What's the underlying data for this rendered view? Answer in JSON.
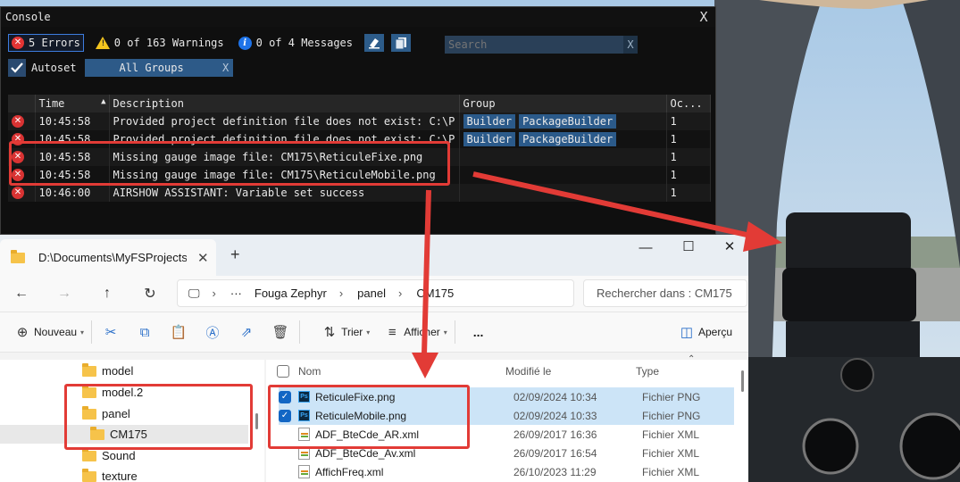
{
  "console": {
    "title": "Console",
    "close": "X",
    "errors_label": "5 Errors",
    "warnings_label": "0 of 163 Warnings",
    "messages_label": "0 of 4 Messages",
    "search_placeholder": "Search",
    "search_clear": "X",
    "autoset_label": "Autoset",
    "groups_label": "All Groups",
    "groups_clear": "X",
    "columns": [
      "Time",
      "Description",
      "Group",
      "Oc..."
    ],
    "rows": [
      {
        "time": "10:45:58",
        "desc": "Provided project definition file does not exist: C:\\P",
        "groups": [
          "Builder",
          "PackageBuilder"
        ],
        "count": "1"
      },
      {
        "time": "10:45:58",
        "desc": "Provided project definition file does not exist: C:\\P",
        "groups": [
          "Builder",
          "PackageBuilder"
        ],
        "count": "1"
      },
      {
        "time": "10:45:58",
        "desc": "Missing gauge image file: CM175\\ReticuleFixe.png",
        "groups": [],
        "count": "1"
      },
      {
        "time": "10:45:58",
        "desc": "Missing gauge image file: CM175\\ReticuleMobile.png",
        "groups": [],
        "count": "1"
      },
      {
        "time": "10:46:00",
        "desc": "AIRSHOW ASSISTANT: Variable set success",
        "groups": [],
        "count": "1"
      }
    ]
  },
  "explorer": {
    "tab_title": "D:\\Documents\\MyFSProjects\\F",
    "tab_close": "✕",
    "new_tab": "+",
    "breadcrumb": [
      "Fouga Zephyr",
      "panel",
      "CM175"
    ],
    "search_placeholder": "Rechercher dans : CM175",
    "commands": {
      "new": "Nouveau",
      "sort": "Trier",
      "view": "Afficher",
      "more": "...",
      "preview": "Aperçu"
    },
    "tree": [
      "model",
      "model.2",
      "panel",
      "CM175",
      "Sound",
      "texture"
    ],
    "columns": {
      "name": "Nom",
      "modified": "Modifié le",
      "type": "Type"
    },
    "files": [
      {
        "name": "ReticuleFixe.png",
        "date": "02/09/2024 10:34",
        "type": "Fichier PNG",
        "selected": true
      },
      {
        "name": "ReticuleMobile.png",
        "date": "02/09/2024 10:33",
        "type": "Fichier PNG",
        "selected": true
      },
      {
        "name": "ADF_BteCde_AR.xml",
        "date": "26/09/2017 16:36",
        "type": "Fichier XML",
        "selected": false
      },
      {
        "name": "ADF_BteCde_Av.xml",
        "date": "26/09/2017 16:54",
        "type": "Fichier XML",
        "selected": false
      },
      {
        "name": "AffichFreq.xml",
        "date": "26/10/2023 11:29",
        "type": "Fichier XML",
        "selected": false
      }
    ]
  },
  "colors": {
    "accent_red": "#e23b36",
    "console_blue": "#2d5a88",
    "explorer_select": "#cce4f7"
  }
}
